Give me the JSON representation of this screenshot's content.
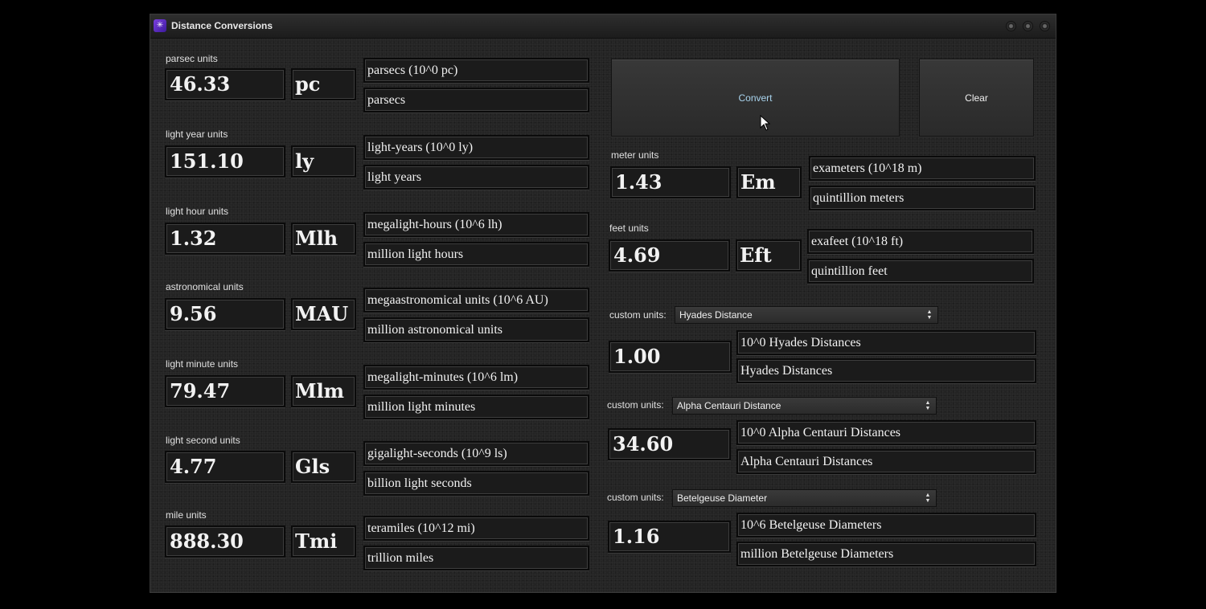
{
  "window": {
    "title": "Distance Conversions"
  },
  "buttons": {
    "convert": "Convert",
    "clear": "Clear"
  },
  "left_units": [
    {
      "label": "parsec units",
      "value": "46.33",
      "symbol": "pc",
      "desc1": "parsecs  (10^0 pc)",
      "desc2": "parsecs"
    },
    {
      "label": "light year units",
      "value": "151.10",
      "symbol": "ly",
      "desc1": "light-years  (10^0 ly)",
      "desc2": "light years"
    },
    {
      "label": "light hour units",
      "value": "1.32",
      "symbol": "Mlh",
      "desc1": "megalight-hours  (10^6 lh)",
      "desc2": "million light hours"
    },
    {
      "label": "astronomical units",
      "value": "9.56",
      "symbol": "MAU",
      "desc1": "megaastronomical units  (10^6 AU)",
      "desc2": "million astronomical units"
    },
    {
      "label": "light minute units",
      "value": "79.47",
      "symbol": "Mlm",
      "desc1": "megalight-minutes  (10^6 lm)",
      "desc2": "million light minutes"
    },
    {
      "label": "light second units",
      "value": "4.77",
      "symbol": "Gls",
      "desc1": "gigalight-seconds  (10^9 ls)",
      "desc2": "billion light seconds"
    },
    {
      "label": "mile units",
      "value": "888.30",
      "symbol": "Tmi",
      "desc1": "teramiles  (10^12 mi)",
      "desc2": "trillion miles"
    }
  ],
  "right_units": [
    {
      "label": "meter units",
      "value": "1.43",
      "symbol": "Em",
      "desc1": "exameters  (10^18 m)",
      "desc2": "quintillion meters"
    },
    {
      "label": "feet units",
      "value": "4.69",
      "symbol": "Eft",
      "desc1": "exafeet  (10^18 ft)",
      "desc2": "quintillion feet"
    }
  ],
  "custom_units": [
    {
      "label": "custom units:",
      "selected": "Hyades Distance",
      "value": "1.00",
      "desc1": "10^0 Hyades Distances",
      "desc2": "Hyades Distances"
    },
    {
      "label": "custom units:",
      "selected": "Alpha Centauri Distance",
      "value": "34.60",
      "desc1": "10^0 Alpha Centauri Distances",
      "desc2": "Alpha Centauri Distances"
    },
    {
      "label": "custom units:",
      "selected": "Betelgeuse Diameter",
      "value": "1.16",
      "desc1": "10^6 Betelgeuse Diameters",
      "desc2": "million Betelgeuse Diameters"
    }
  ],
  "colors": {
    "window_bg": "#242424",
    "box_bg": "#1b1b1b",
    "text": "#f2f2f2",
    "convert_text": "#a9d4ee"
  }
}
